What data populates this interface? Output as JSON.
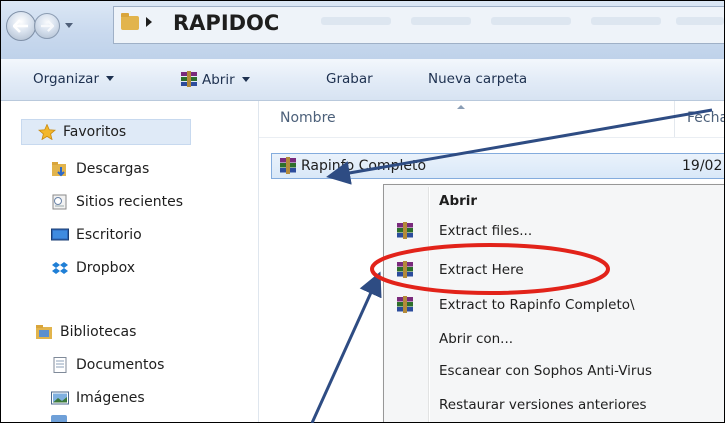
{
  "address": {
    "folder": "RAPIDOC"
  },
  "toolbar": {
    "organize": "Organizar",
    "open": "Abrir",
    "burn": "Grabar",
    "new_folder": "Nueva carpeta"
  },
  "nav": {
    "favorites": "Favoritos",
    "downloads": "Descargas",
    "recent": "Sitios recientes",
    "desktop": "Escritorio",
    "dropbox": "Dropbox",
    "libraries": "Bibliotecas",
    "documents": "Documentos",
    "images": "Imágenes"
  },
  "columns": {
    "name": "Nombre",
    "date": "Fecha"
  },
  "file": {
    "name": "Rapinfo Completo",
    "date": "19/02"
  },
  "context_menu": {
    "items": [
      "Abrir",
      "Extract files...",
      "Extract Here",
      "Extract to Rapinfo Completo\\",
      "Abrir con...",
      "Escanear con Sophos Anti-Virus",
      "Restaurar versiones anteriores"
    ]
  },
  "colors": {
    "annotation_arrow": "#2e4c83",
    "highlight_ellipse": "#e2231a",
    "selection": "#d9e8f8"
  }
}
